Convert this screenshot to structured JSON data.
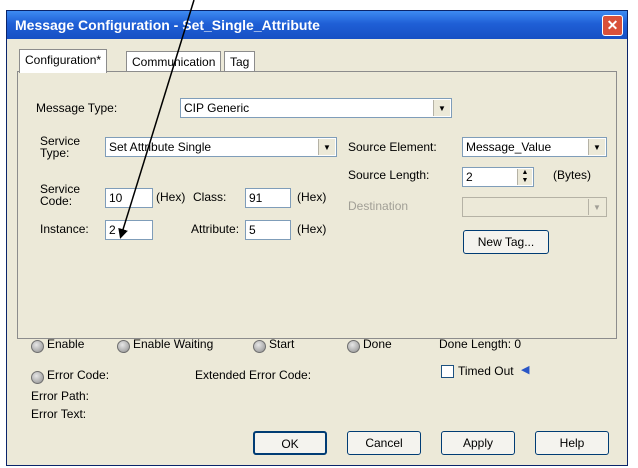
{
  "window": {
    "title": "Message Configuration - Set_Single_Attribute"
  },
  "tabs": [
    "Configuration*",
    "Communication",
    "Tag"
  ],
  "config": {
    "message_type_label": "Message Type:",
    "message_type_value": "CIP Generic",
    "service_type_label": "Service\nType:",
    "service_type_value": "Set Attribute Single",
    "service_code_label": "Service\nCode:",
    "service_code_value": "10",
    "hex1": "(Hex)",
    "class_label": "Class:",
    "class_value": "91",
    "hex2": "(Hex)",
    "instance_label": "Instance:",
    "instance_value": "2",
    "attribute_label": "Attribute:",
    "attribute_value": "5",
    "hex3": "(Hex)",
    "source_element_label": "Source Element:",
    "source_element_value": "Message_Value",
    "source_length_label": "Source Length:",
    "source_length_value": "2",
    "bytes_label": "(Bytes)",
    "destination_label": "Destination",
    "destination_value": "",
    "new_tag_label": "New Tag..."
  },
  "status": {
    "enable": "Enable",
    "enable_waiting": "Enable Waiting",
    "start": "Start",
    "done": "Done",
    "done_length": "Done Length: 0",
    "error_code": "Error Code:",
    "extended_error_code": "Extended Error Code:",
    "timed_out": "Timed Out",
    "error_path": "Error Path:",
    "error_text": "Error Text:"
  },
  "buttons": {
    "ok": "OK",
    "cancel": "Cancel",
    "apply": "Apply",
    "help": "Help"
  },
  "colors": {
    "titlebar": "#1f5fd6",
    "dialog_bg": "#ece9d8",
    "arrow_annotation": "#000000"
  }
}
